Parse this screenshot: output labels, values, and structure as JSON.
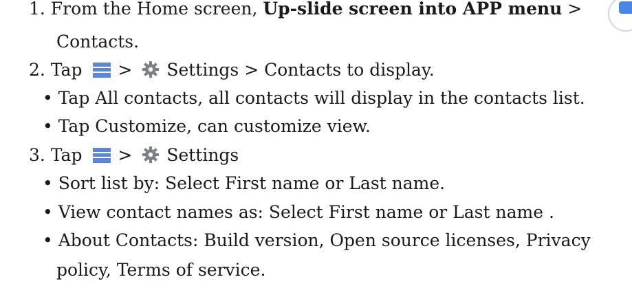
{
  "steps": {
    "step1": {
      "prefix": "1. From the Home screen, ",
      "bold": "Up-slide screen into APP menu",
      "suffix": " >",
      "line2": "Contacts.",
      "icon": "contacts-app-icon"
    },
    "step2": {
      "prefix": "2. Tap",
      "separator": ">",
      "settings_label": "Settings > Contacts to display.",
      "bullets": [
        "• Tap All contacts, all contacts will display in the contacts list.",
        "• Tap Customize, can customize view."
      ],
      "icons": [
        "menu-icon",
        "gear-icon"
      ]
    },
    "step3": {
      "prefix": "3. Tap",
      "separator": ">",
      "settings_label": "Settings",
      "bullets": [
        "• Sort list by: Select First name or Last name.",
        "• View contact names as: Select First name or Last name .",
        "• About Contacts: Build version, Open source licenses, Privacy",
        "policy, Terms of service."
      ],
      "icons": [
        "menu-icon",
        "gear-icon"
      ]
    }
  },
  "colors": {
    "text": "#1a1a1a",
    "menu_icon_blue": "#3f6fd8",
    "gear_gray": "#7a8088"
  }
}
